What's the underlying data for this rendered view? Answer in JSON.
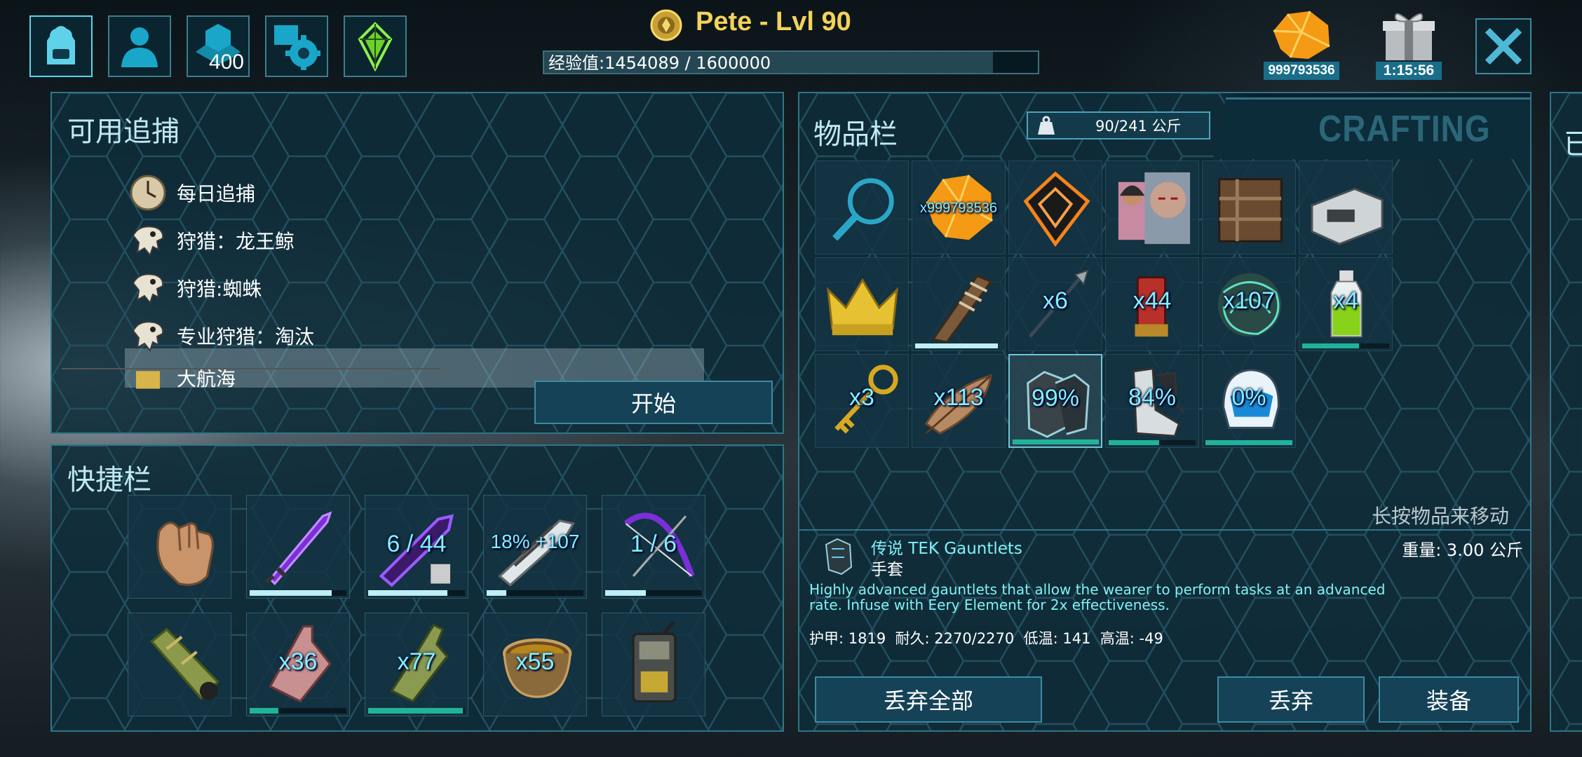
{
  "header": {
    "player_name": "Pete - Lvl 90",
    "xp_text": "经验值:1454089 / 1600000",
    "xp_fraction": 0.909
  },
  "top_icons": [
    {
      "name": "backpack-icon",
      "selected": true
    },
    {
      "name": "character-icon"
    },
    {
      "name": "engrams-icon",
      "badge": "400"
    },
    {
      "name": "settings-icon"
    },
    {
      "name": "tek-crystal-icon"
    }
  ],
  "top_right": {
    "element_count": "999793536",
    "gift_timer": "1:15:56"
  },
  "hunts": {
    "title": "可用追捕",
    "items": [
      "每日追捕",
      "狩猎：龙王鲸",
      "狩猎:蜘蛛",
      "专业狩猎：淘汰",
      "大航海"
    ],
    "selected_index": 2,
    "start_button": "开始"
  },
  "hotbar": {
    "title": "快捷栏",
    "slots": [
      {
        "icon": "hand-icon"
      },
      {
        "icon": "tek-sword-icon",
        "durability": 0.85
      },
      {
        "icon": "tek-rifle-icon",
        "label": "6 / 44",
        "durability": 0.82
      },
      {
        "icon": "tek-railgun-icon",
        "label": "18% +107",
        "durability": 0.2
      },
      {
        "icon": "tek-bow-icon",
        "label": "1 / 6",
        "durability": 0.42
      },
      {
        "icon": "spyglass-icon"
      },
      {
        "icon": "potion-red-icon",
        "label": "x36",
        "durability": 0.3,
        "green": true
      },
      {
        "icon": "potion-green-icon",
        "label": "x77",
        "durability": 0.98,
        "green": true
      },
      {
        "icon": "bowl-icon",
        "label": "x55"
      },
      {
        "icon": "radio-icon"
      }
    ]
  },
  "inventory": {
    "title": "物品栏",
    "weight": "90/241 公斤",
    "crafting_tab": "CRAFTING",
    "hint": "长按物品来移动",
    "slots": [
      {
        "icon": "search-icon"
      },
      {
        "icon": "element-icon",
        "label": "x999793536",
        "small": true
      },
      {
        "icon": "tek-implant-icon"
      },
      {
        "icon": "character-portraits-icon"
      },
      {
        "icon": "smithy-icon"
      },
      {
        "icon": "fabricator-icon"
      },
      {
        "icon": "crown-icon"
      },
      {
        "icon": "torch-icon",
        "durability": 0.95
      },
      {
        "icon": "spear-icon",
        "label": "x6"
      },
      {
        "icon": "shotgun-shell-icon",
        "label": "x44"
      },
      {
        "icon": "fiber-net-icon",
        "label": "x107"
      },
      {
        "icon": "potion-bottle-icon",
        "label": "x4",
        "fill": 0.65
      },
      {
        "icon": "key-icon",
        "label": "x3"
      },
      {
        "icon": "feather-icon",
        "label": "x113"
      },
      {
        "icon": "tek-gauntlets-icon",
        "label": "99%",
        "fill": 0.99
      },
      {
        "icon": "tek-boots-icon",
        "label": "84%",
        "fill": 0.58
      },
      {
        "icon": "tek-helmet-icon",
        "label": "0%",
        "fill": 1.0
      }
    ],
    "selected_index": 14
  },
  "item_detail": {
    "name": "传说 TEK Gauntlets",
    "type": "手套",
    "weight": "重量: 3.00 公斤",
    "description_line1": "Highly advanced gauntlets that allow the wearer to perform tasks at an advanced",
    "description_line2": "rate. Infuse with Eery Element for 2x effectiveness.",
    "stats": "护甲: 1819  耐久: 2270/2270  低温: 141  高温: -49"
  },
  "buttons": {
    "drop_all": "丢弃全部",
    "drop": "丢弃",
    "equip": "装备"
  },
  "right_tab_char": "已",
  "colors": {
    "accent": "#5fd2ea",
    "gold": "#f3d25a",
    "cyan_text": "#7ff2f8",
    "bar_green": "#1fb39a"
  }
}
